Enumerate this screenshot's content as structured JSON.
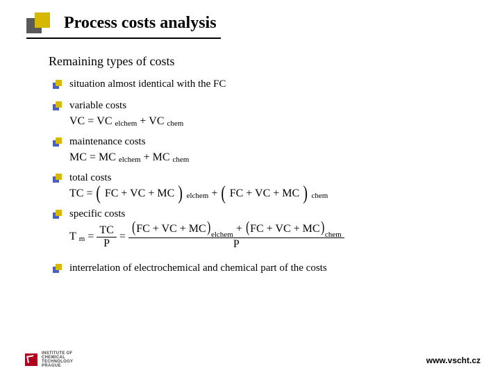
{
  "title": "Process costs analysis",
  "subtitle": "Remaining types of costs",
  "items": [
    {
      "label": "situation almost identical with the FC"
    },
    {
      "label": "variable costs",
      "formula": {
        "lhs": "VC",
        "rhs_a": "VC",
        "sub_a": "elchem",
        "plus": " + ",
        "rhs_b": "VC",
        "sub_b": "chem"
      }
    },
    {
      "label": "maintenance costs",
      "formula": {
        "lhs": "MC",
        "rhs_a": "MC",
        "sub_a": "elchem",
        "plus": " + ",
        "rhs_b": "MC",
        "sub_b": "chem"
      }
    },
    {
      "label": "total costs",
      "formula_tc": {
        "lhs": "TC",
        "group": "FC + VC + MC",
        "sub_a": "elchem",
        "sub_b": "chem",
        "plus": " + "
      }
    },
    {
      "label": "specific costs",
      "formula_tm": {
        "lhs": "T",
        "lhs_sub": "m",
        "num1": "TC",
        "den1": "P",
        "group": "FC + VC + MC",
        "sub_a": "elchem",
        "sub_b": "chem",
        "den2": "P",
        "plus": " + "
      }
    },
    {
      "label": "interrelation of electrochemical and chemical part of the costs"
    }
  ],
  "logo": {
    "line1": "INSTITUTE OF",
    "line2": "CHEMICAL",
    "line3": "TECHNOLOGY",
    "line4": "PRAGUE"
  },
  "footer_url": "www.vscht.cz",
  "eq": " = "
}
